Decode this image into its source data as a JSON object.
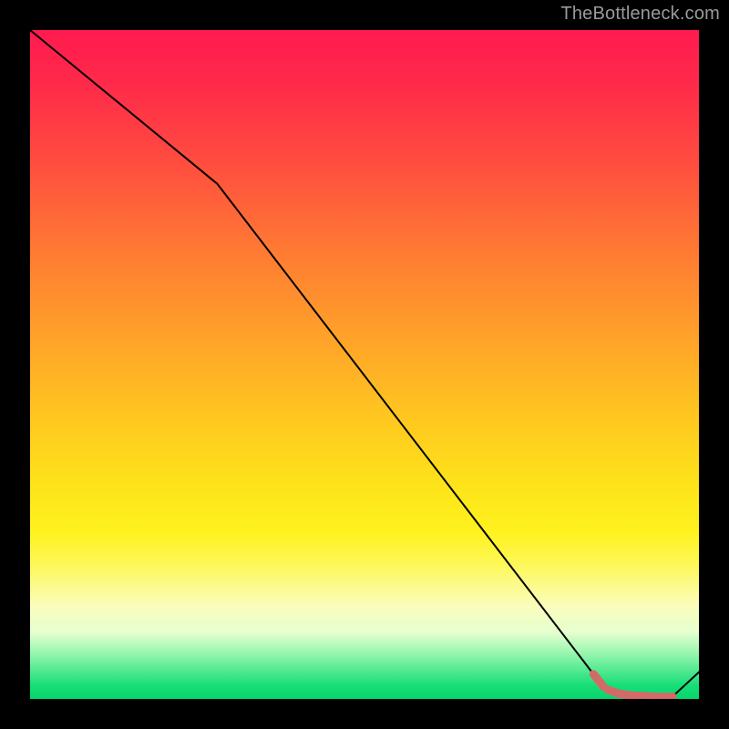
{
  "watermark": "TheBottleneck.com",
  "chart_data": {
    "type": "line",
    "title": "",
    "xlabel": "",
    "ylabel": "",
    "xlim": [
      0,
      100
    ],
    "ylim": [
      0,
      100
    ],
    "series": [
      {
        "name": "curve",
        "x": [
          0,
          28,
          84,
          86,
          88,
          90,
          92,
          94,
          96,
          100
        ],
        "y": [
          100,
          77,
          4,
          1.5,
          0.8,
          0.5,
          0.4,
          0.3,
          0.3,
          4
        ]
      }
    ],
    "dash_segment": {
      "x": [
        84,
        86,
        88,
        90,
        92,
        94,
        96
      ],
      "y": [
        4,
        1.5,
        0.8,
        0.5,
        0.4,
        0.3,
        0.3
      ]
    },
    "end_marker": {
      "x": 96,
      "y": 0.3
    },
    "background_gradient": {
      "top": "#ff1a4f",
      "mid": "#ffe018",
      "bottom": "#06d66d"
    }
  }
}
